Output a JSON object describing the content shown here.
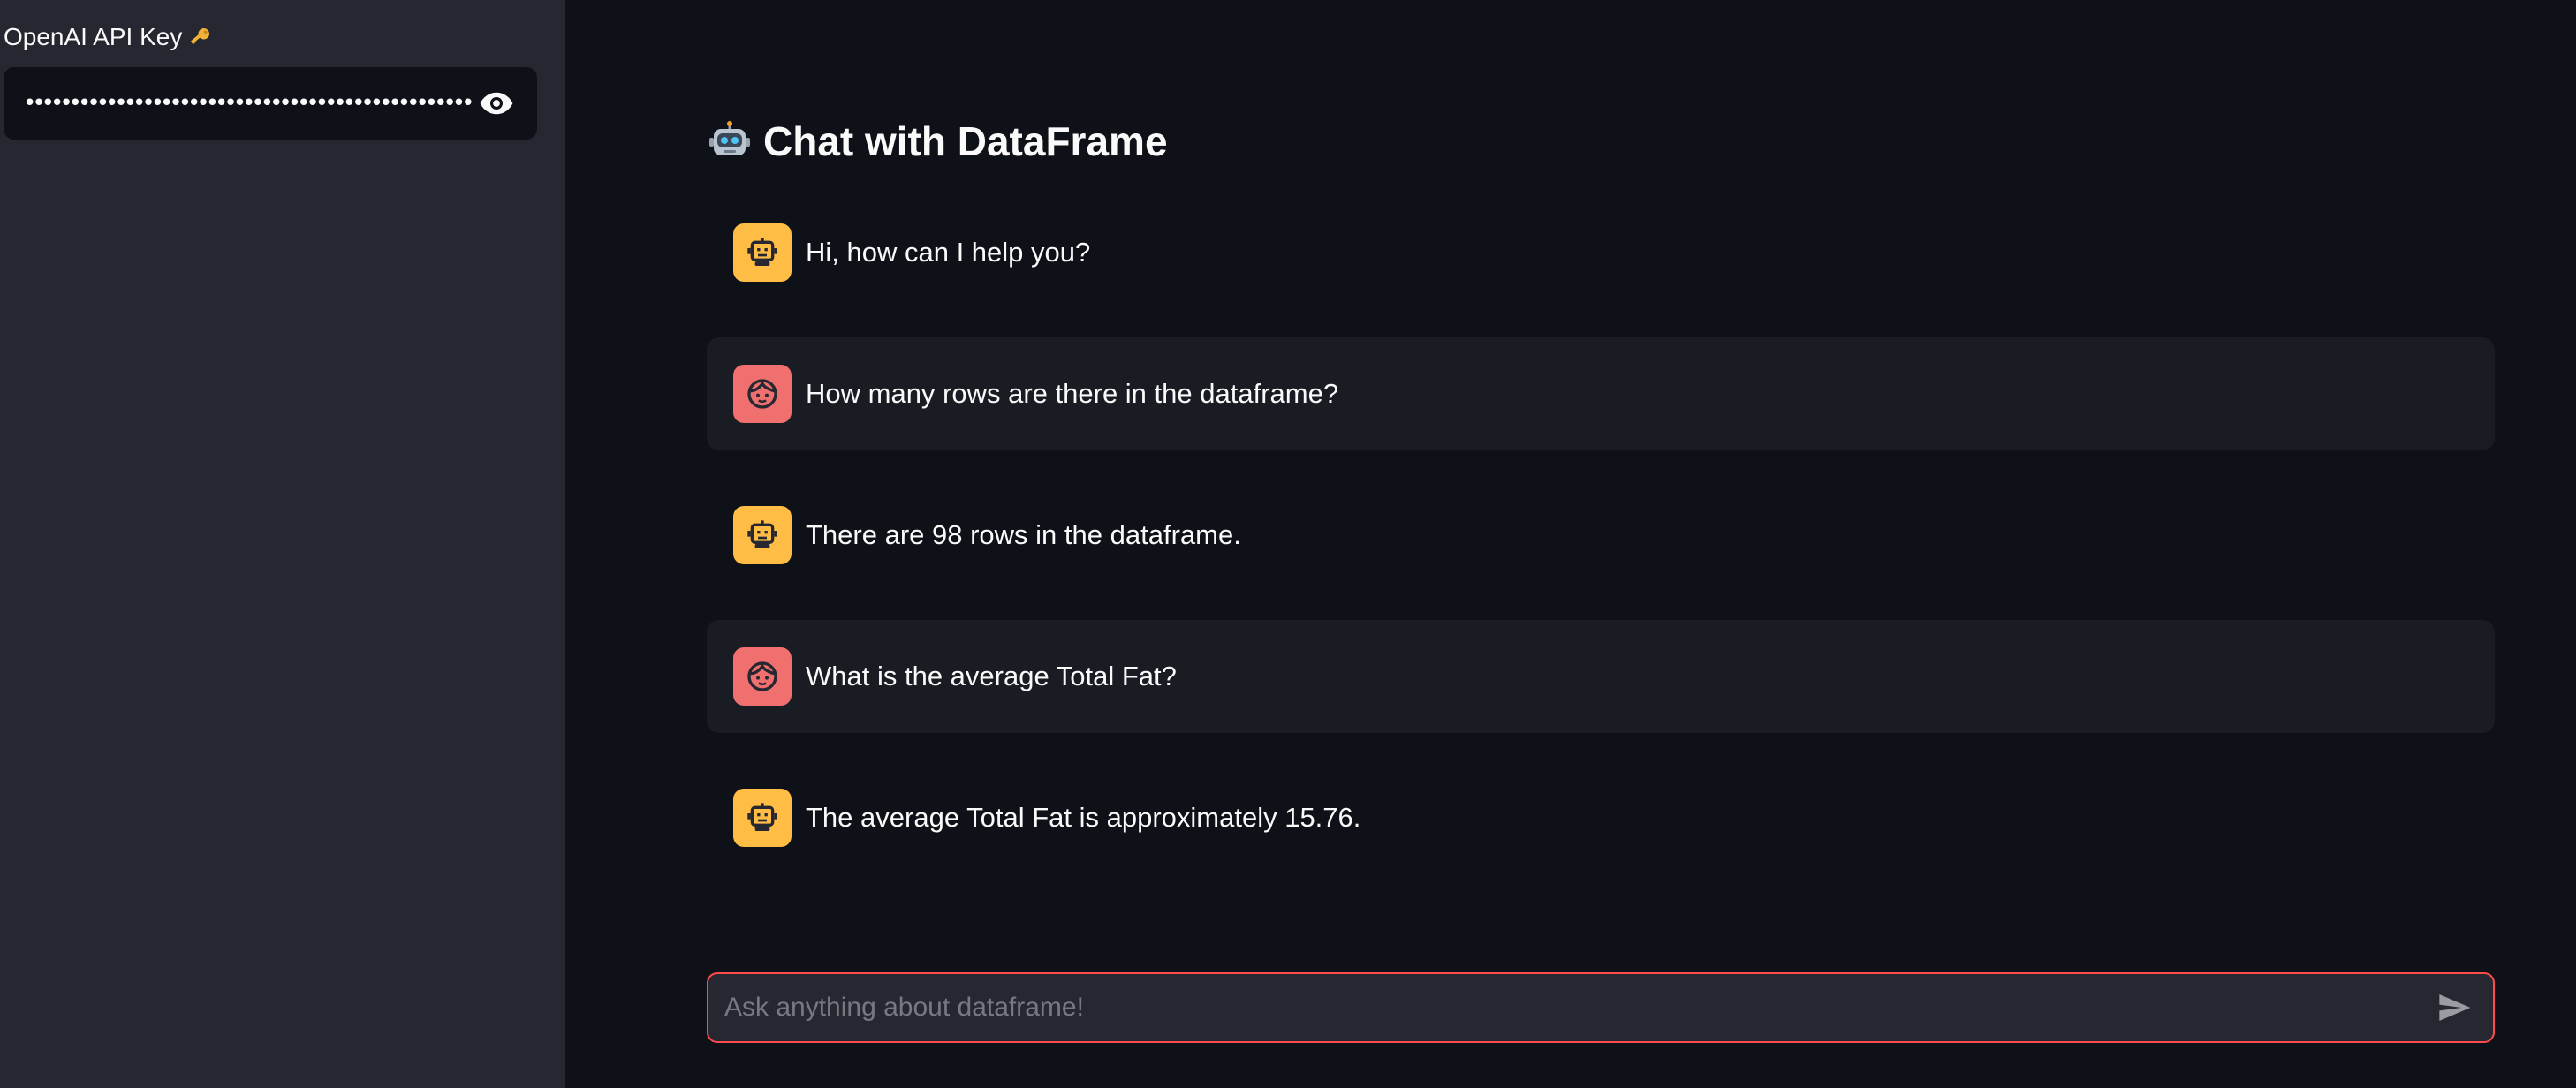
{
  "sidebar": {
    "api_key_label": "OpenAI API Key",
    "api_key_label_icon": "key-icon",
    "api_key_value": "•••••••••••••••••••••••••••••••••••••••••••••••••••",
    "toggle_visibility_icon": "eye-icon"
  },
  "main": {
    "title": "Chat with DataFrame",
    "title_icon": "robot-icon",
    "messages": [
      {
        "role": "assistant",
        "avatar": "bot-icon",
        "text": "Hi, how can I help you?"
      },
      {
        "role": "user",
        "avatar": "user-face-icon",
        "text": "How many rows are there in the dataframe?"
      },
      {
        "role": "assistant",
        "avatar": "bot-icon",
        "text": "There are 98 rows in the dataframe."
      },
      {
        "role": "user",
        "avatar": "user-face-icon",
        "text": "What is the average Total Fat?"
      },
      {
        "role": "assistant",
        "avatar": "bot-icon",
        "text": "The average Total Fat is approximately 15.76."
      }
    ],
    "chat_input": {
      "placeholder": "Ask anything about dataframe!",
      "value": "",
      "send_icon": "send-icon"
    }
  },
  "colors": {
    "background": "#0e1117",
    "sidebar": "#262730",
    "assistant_avatar": "#ffbd45",
    "user_avatar": "#f07070",
    "input_border": "#ff4b4b"
  }
}
